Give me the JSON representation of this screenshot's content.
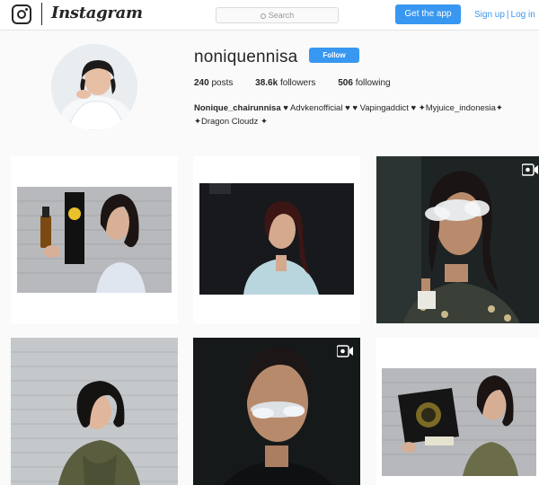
{
  "nav": {
    "wordmark": "Instagram",
    "search_placeholder": "Search",
    "get_app": "Get the app",
    "sign_up": "Sign up",
    "separator": "|",
    "log_in": "Log in"
  },
  "profile": {
    "username": "noniquennisa",
    "follow_label": "Follow",
    "stats": {
      "posts": "240",
      "posts_label": "posts",
      "followers": "38.6k",
      "followers_label": "followers",
      "following": "506",
      "following_label": "following"
    },
    "bio_name": "Nonique_chairunnisa",
    "bio_line1": " ♥ Advkenofficial ♥ ♥ Vapingaddict ♥ ✦Myjuice_indonesia✦",
    "bio_line2": "✦Dragon Cloudz ✦"
  },
  "posts": [
    {
      "id": "post-1",
      "video": false
    },
    {
      "id": "post-2",
      "video": false
    },
    {
      "id": "post-3",
      "video": true
    },
    {
      "id": "post-4",
      "video": false
    },
    {
      "id": "post-5",
      "video": true
    },
    {
      "id": "post-6",
      "video": false
    }
  ],
  "colors": {
    "accent": "#3897f0",
    "text": "#262626",
    "background": "#fafafa"
  }
}
